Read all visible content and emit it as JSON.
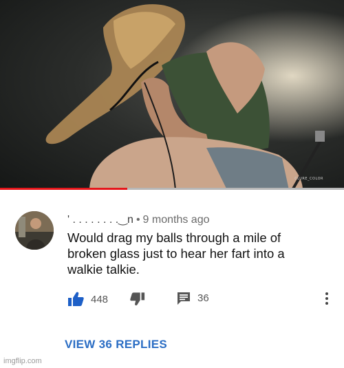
{
  "video": {
    "watermark": "CLURE_COLOR",
    "progress_fraction": 0.37,
    "colors": {
      "progress_played": "#e5161b",
      "progress_track": "#b7b7b7"
    }
  },
  "comment": {
    "author": "' . . . . . . . .‿n",
    "separator": "•",
    "time": "9 months ago",
    "text": "Would drag my balls through a mile of broken glass just to hear her fart into a walkie talkie.",
    "likes": "448",
    "reply_count": "36",
    "view_replies": "VIEW 36 REPLIES",
    "colors": {
      "link": "#2a6dc4",
      "like_icon": "#1d5fc7"
    }
  },
  "icons": {
    "like": "thumbs-up-icon",
    "dislike": "thumbs-down-icon",
    "reply": "reply-comment-icon",
    "more": "more-vertical-icon"
  },
  "site_watermark": "imgflip.com"
}
